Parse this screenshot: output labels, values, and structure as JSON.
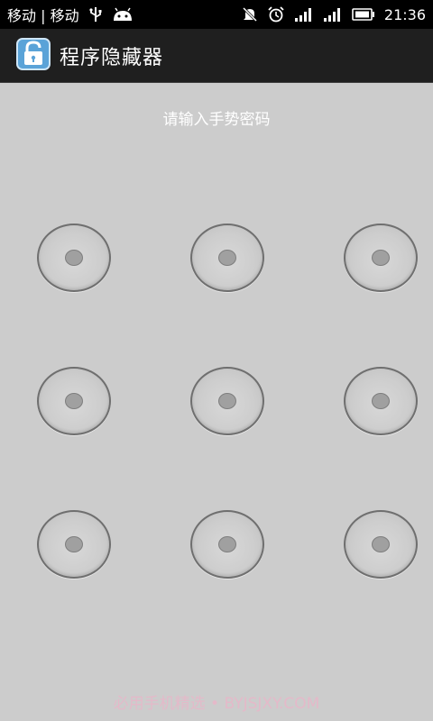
{
  "status_bar": {
    "carrier": "移动 | 移动",
    "time": "21:36",
    "icons": [
      "usb-icon",
      "android-icon",
      "mute-icon",
      "alarm-icon",
      "signal-icon",
      "signal-icon",
      "battery-icon"
    ]
  },
  "app_bar": {
    "title": "程序隐藏器",
    "icon": "lock-icon"
  },
  "pattern": {
    "hint": "请输入手势密码",
    "rows": 3,
    "columns": 3
  },
  "watermark": "必用手机精选 • BYJSJXY.COM"
}
